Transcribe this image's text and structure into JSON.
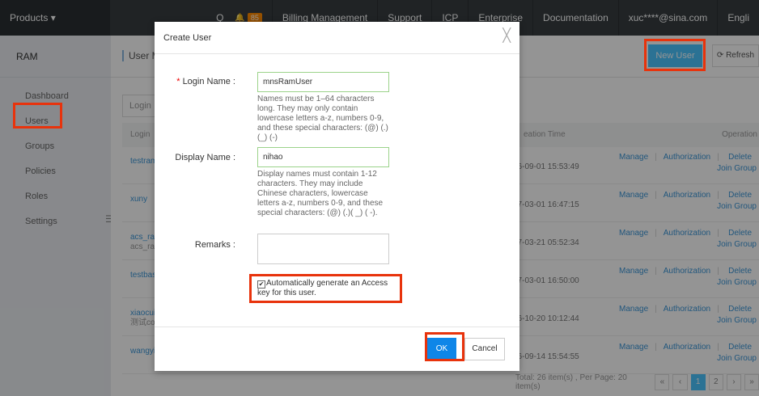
{
  "topbar": {
    "products": "Products ▾",
    "search_glyph": "Q",
    "bell_glyph": "🔔",
    "notification_count": "85",
    "billing": "Billing Management",
    "support": "Support",
    "icp": "ICP",
    "enterprise": "Enterprise",
    "documentation": "Documentation",
    "account": "xuc****@sina.com",
    "language": "Engli"
  },
  "sidebar": {
    "title": "RAM",
    "items": [
      {
        "label": "Dashboard"
      },
      {
        "label": "Users"
      },
      {
        "label": "Groups"
      },
      {
        "label": "Policies"
      },
      {
        "label": "Roles"
      },
      {
        "label": "Settings"
      }
    ],
    "collapse_glyph": "☰"
  },
  "main": {
    "breadcrumb": "User M",
    "new_user_label": "New User",
    "refresh_label": "Refresh",
    "refresh_glyph": "⟳",
    "search_placeholder": "Login",
    "columns": {
      "login": "Login",
      "created": "eation Time",
      "operation": "Operation"
    },
    "rows": [
      {
        "name": "testram",
        "sub": "",
        "time": "16-09-01 15:53:49"
      },
      {
        "name": "xuny",
        "sub": "",
        "time": "17-03-01 16:47:15"
      },
      {
        "name": "acs_ra",
        "sub": "acs_ra",
        "time": "17-03-21 05:52:34"
      },
      {
        "name": "testbas",
        "sub": "",
        "time": "17-03-01 16:50:00"
      },
      {
        "name": "xiaocui",
        "sub": "测试co",
        "time": "16-10-20 10:12:44"
      },
      {
        "name": "wangyi",
        "sub": "",
        "time": "16-09-14 15:54:55"
      }
    ],
    "op_manage": "Manage",
    "op_authorization": "Authorization",
    "op_delete": "Delete",
    "op_join_group": "Join Group",
    "op_sep": "|",
    "pager": {
      "summary": "Total: 26 item(s) , Per Page: 20 item(s)",
      "first": "«",
      "prev": "‹",
      "pages": [
        "1",
        "2"
      ],
      "next": "›",
      "last": "»"
    }
  },
  "dialog": {
    "title": "Create User",
    "close_glyph": "╳",
    "login_name_required_mark": "*",
    "login_name_label": "Login Name :",
    "login_name_value": "mnsRamUser",
    "login_name_hint": "Names must be 1–64 characters long. They may only contain lowercase letters a-z, numbers 0-9, and these special characters: (@) (.) (_) (-)",
    "display_name_label": "Display Name :",
    "display_name_value": "nihao",
    "display_name_hint": "Display names must contain 1-12 characters. They may include Chinese characters, lowercase letters a-z, numbers 0-9, and these special characters: (@) (.)( _) ( -).",
    "remarks_label": "Remarks :",
    "auto_key_checkbox_glyph": "✔",
    "auto_key_label": "Automatically generate an Access key for this user.",
    "auto_key_checked": true,
    "ok_label": "OK",
    "cancel_label": "Cancel"
  },
  "colors": {
    "topbar_bg": "#373d41",
    "accent_blue": "#4ac4ff",
    "primary_button": "#0e86e8",
    "highlight_red": "#e8330c",
    "link_blue": "#3b96d8"
  }
}
